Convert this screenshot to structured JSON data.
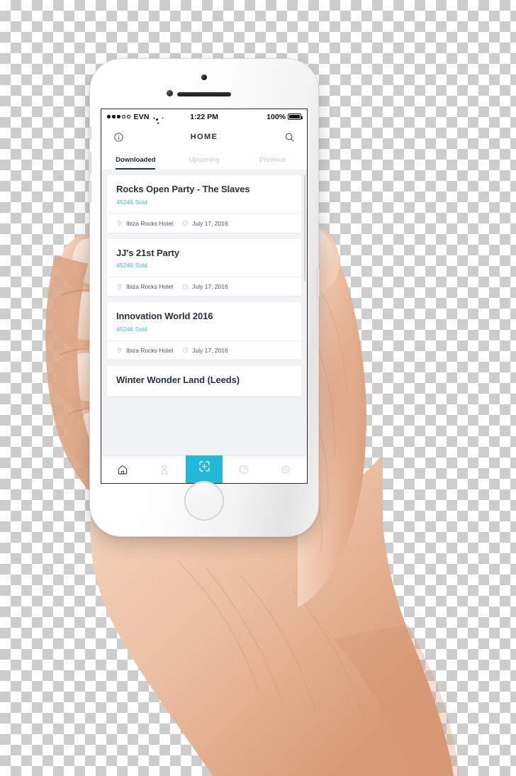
{
  "phone": {
    "hardware": {
      "camera": "camera-dot",
      "speaker": "earpiece-speaker",
      "sensor": "proximity-sensor",
      "home_button": "home-button",
      "buttons": [
        "mute-switch",
        "volume-up",
        "volume-down",
        "power-button"
      ]
    }
  },
  "status_bar": {
    "signal_dots_filled": 3,
    "signal_dots_empty": 2,
    "carrier": "EVN",
    "wifi": "wifi-icon",
    "time": "1:22 PM",
    "battery_percent": "100%",
    "battery_icon": "battery-full-icon"
  },
  "nav_bar": {
    "info_icon": "info-circle-icon",
    "title": "HOME",
    "search_icon": "search-icon"
  },
  "tabs": [
    {
      "label": "Downloaded",
      "active": true
    },
    {
      "label": "Upcoming",
      "active": false
    },
    {
      "label": "Previous",
      "active": false
    }
  ],
  "events": [
    {
      "title": "Rocks Open Party - The Slaves",
      "sold": "45246 Sold",
      "venue": "Ibiza Rocks Hotel",
      "date": "July 17, 2016"
    },
    {
      "title": "JJ's 21st Party",
      "sold": "45246 Sold",
      "venue": "Ibiza Rocks Hotel",
      "date": "July 17, 2016"
    },
    {
      "title": "Innovation World 2016",
      "sold": "45246 Sold",
      "venue": "Ibiza Rocks Hotel",
      "date": "July 17, 2016"
    },
    {
      "title": "Winter Wonder Land (Leeds)",
      "sold": "",
      "venue": "",
      "date": ""
    }
  ],
  "tab_bar": [
    {
      "icon": "home-icon",
      "active": true,
      "highlight": false
    },
    {
      "icon": "person-icon",
      "active": false,
      "highlight": false
    },
    {
      "icon": "scan-icon",
      "active": false,
      "highlight": true
    },
    {
      "icon": "pie-chart-icon",
      "active": false,
      "highlight": false
    },
    {
      "icon": "settings-gear-icon",
      "active": false,
      "highlight": false
    }
  ],
  "colors": {
    "accent": "#22b8d8",
    "sold_text": "#3cb8d4",
    "title_text": "#2a313a",
    "inactive_tab": "#c3c7cb",
    "screen_bg": "#f1f2f3",
    "skin": "#e8b394"
  }
}
